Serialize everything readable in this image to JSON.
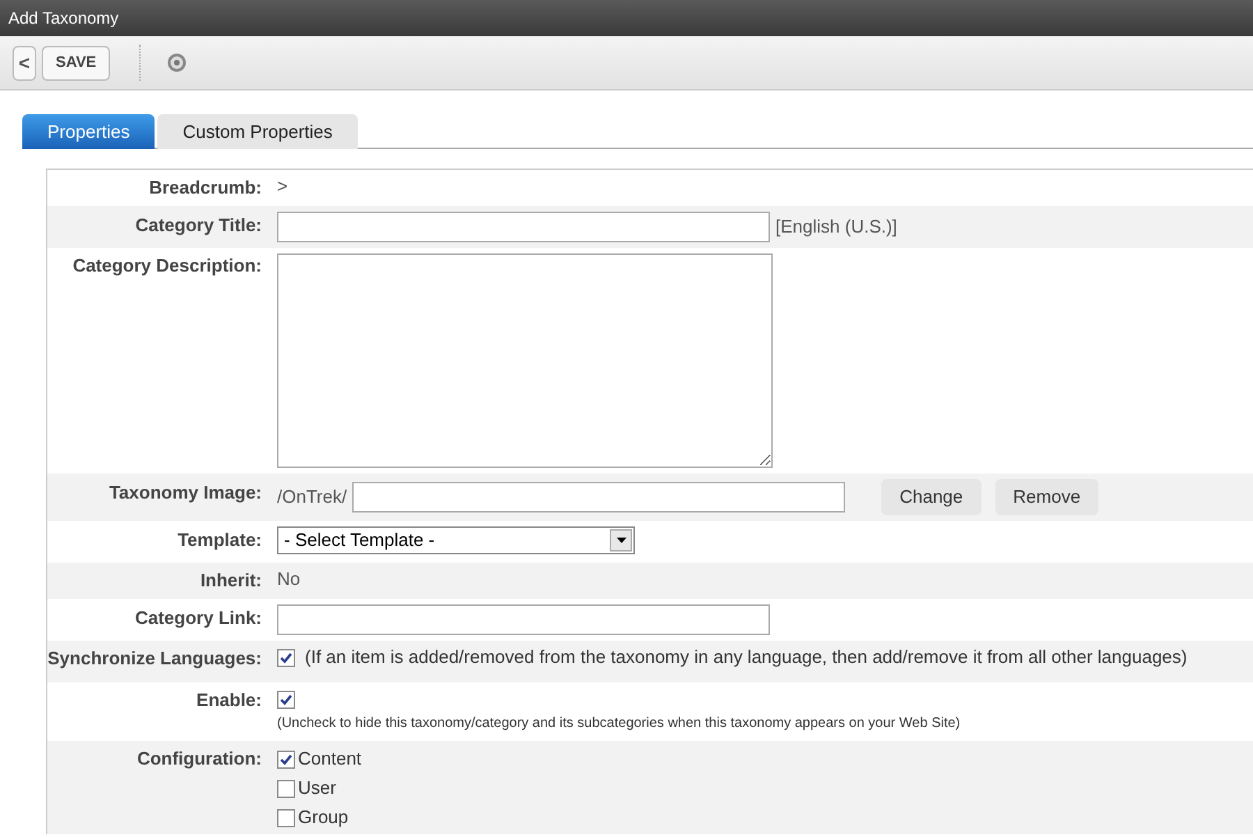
{
  "window": {
    "title": "Add Taxonomy"
  },
  "toolbar": {
    "back": "<",
    "save": "SAVE"
  },
  "tabs": [
    {
      "label": "Properties",
      "selected": true
    },
    {
      "label": "Custom Properties",
      "selected": false
    }
  ],
  "rows": [
    {
      "kind": "text",
      "label": "Breadcrumb:",
      "value": ">"
    },
    {
      "kind": "input",
      "label": "Category Title:",
      "suffix": "[English (U.S.)]"
    },
    {
      "kind": "textarea",
      "label": "Category Description:"
    },
    {
      "kind": "image",
      "label": "Taxonomy Image:",
      "prefix": "/OnTrek/",
      "buttons": [
        "Change",
        "Remove"
      ]
    },
    {
      "kind": "select",
      "label": "Template:",
      "value": "- Select Template -"
    },
    {
      "kind": "text",
      "label": "Inherit:",
      "value": "No"
    },
    {
      "kind": "input",
      "label": "Category Link:"
    },
    {
      "kind": "check",
      "label": "Synchronize Languages:",
      "checked": true,
      "note": "(If an item is added/removed from the taxonomy in any language, then add/remove it from all other languages)"
    },
    {
      "kind": "checknote",
      "label": "Enable:",
      "checked": true,
      "note": "(Uncheck to hide this taxonomy/category and its subcategories when this taxonomy appears on your Web Site)"
    },
    {
      "kind": "options",
      "label": "Configuration:",
      "options": [
        {
          "label": "Content",
          "checked": true
        },
        {
          "label": "User",
          "checked": false
        },
        {
          "label": "Group",
          "checked": false
        }
      ]
    }
  ]
}
